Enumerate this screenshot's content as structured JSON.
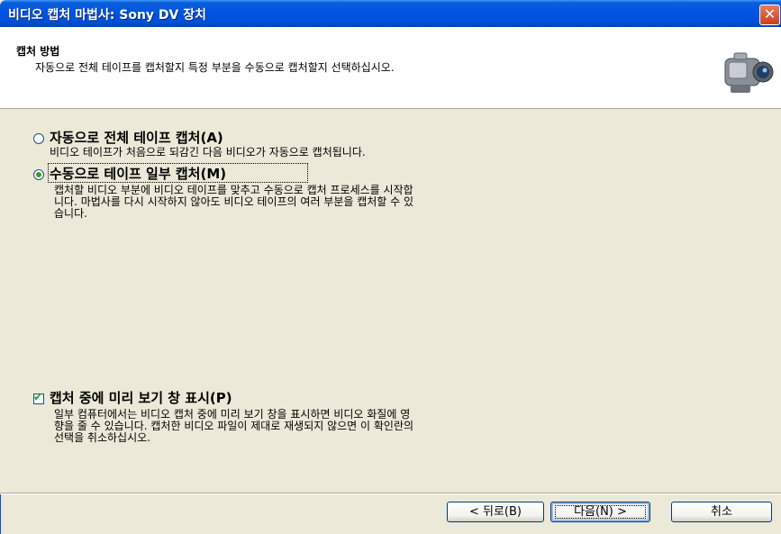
{
  "window": {
    "title": "비디오 캡처 마법사: Sony DV 장치",
    "close_symbol": "✕"
  },
  "header": {
    "title": "캡처 방법",
    "subtitle": "자동으로 전체 테이프를 캡처할지 특정 부분을 수동으로 캡처할지 선택하십시오."
  },
  "options": [
    {
      "label": "자동으로 전체 테이프 캡처(A)",
      "description": "비디오 테이프가 처음으로 되감긴 다음 비디오가 자동으로 캡처됩니다.",
      "selected": false
    },
    {
      "label": "수동으로 테이프 일부 캡처(M)",
      "description_lines": [
        "캡처할 비디오 부분에 비디오 테이프를 맞추고 수동으로 캡처 프로세스를 시작합",
        "니다. 마법사를 다시 시작하지 않아도 비디오 테이프의 여러 부분을 캡처할 수 있",
        "습니다."
      ],
      "selected": true
    }
  ],
  "preview": {
    "label": "캡처 중에 미리 보기 창 표시(P)",
    "checked": true,
    "description_lines": [
      "일부 컴퓨터에서는 비디오 캡처 중에 미리 보기 창을 표시하면 비디오 화질에 영",
      "향을 줄 수 있습니다. 캡처한 비디오 파일이 제대로 재생되지 않으면 이 확인란의",
      "선택을 취소하십시오."
    ]
  },
  "buttons": {
    "back": "< 뒤로(B)",
    "next": "다음(N) >",
    "cancel": "취소"
  },
  "icons": {
    "header": "camcorder-icon",
    "close": "close-icon"
  },
  "colors": {
    "titlebar": "#0054e3",
    "dialog_bg": "#ece9d8",
    "radio_dot": "#3b9b2b",
    "check": "#21a121"
  }
}
